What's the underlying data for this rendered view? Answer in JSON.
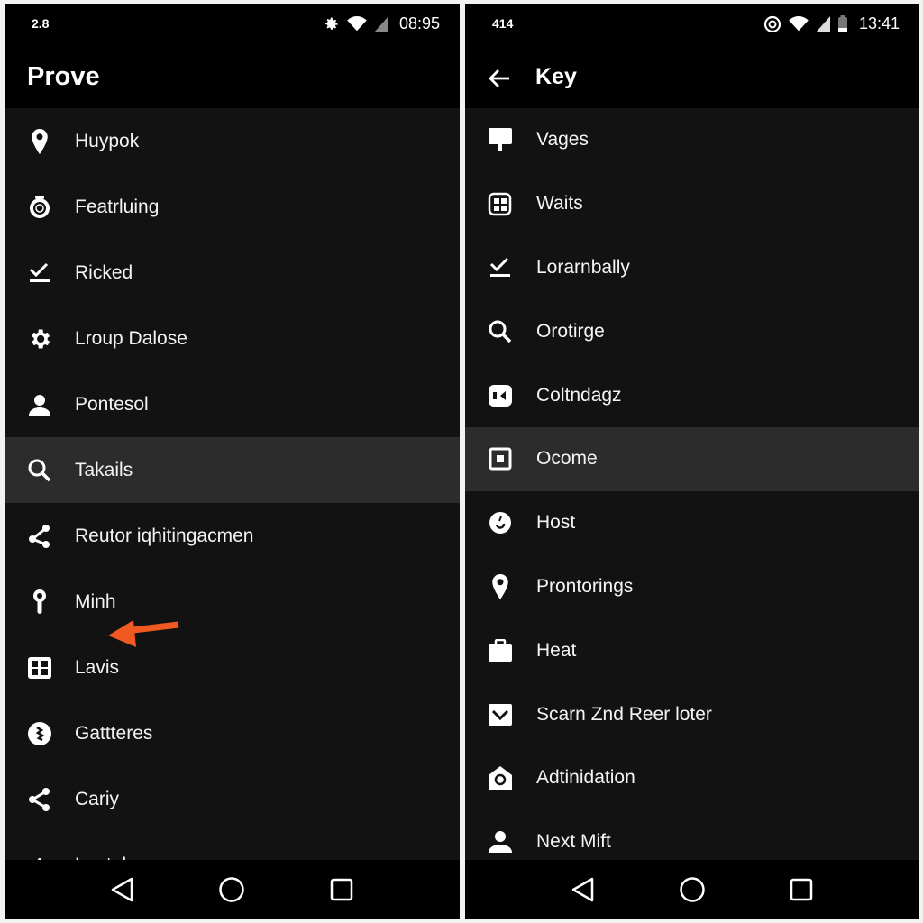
{
  "left_screen": {
    "status": {
      "left_text": "2.8",
      "time": "08:95",
      "icons": [
        "settings-icon",
        "wifi-icon",
        "signal-icon"
      ]
    },
    "title": "Prove",
    "items": [
      {
        "icon": "location-pin-icon",
        "label": "Huypok"
      },
      {
        "icon": "camera-ring-icon",
        "label": "Featrluing"
      },
      {
        "icon": "download-check-icon",
        "label": "Ricked"
      },
      {
        "icon": "gear-icon",
        "label": "Lroup Dalose"
      },
      {
        "icon": "person-icon",
        "label": "Pontesol"
      },
      {
        "icon": "search-icon",
        "label": "Takails",
        "selected": true
      },
      {
        "icon": "share-icon",
        "label": "Reutor iqhitingacmen"
      },
      {
        "icon": "key-pin-icon",
        "label": "Minh"
      },
      {
        "icon": "grid-card-icon",
        "label": "Lavis"
      },
      {
        "icon": "badge-circle-icon",
        "label": "Gattteres"
      },
      {
        "icon": "share-icon",
        "label": "Cariy"
      },
      {
        "icon": "bar-icon",
        "label": "Lautolas"
      }
    ],
    "annotation": {
      "type": "arrow",
      "color": "#f05a22",
      "points_to": "Minh"
    }
  },
  "right_screen": {
    "status": {
      "left_text": "414",
      "time": "13:41",
      "icons": [
        "at-icon",
        "wifi-icon",
        "signal-icon",
        "battery-icon"
      ]
    },
    "title": "Key",
    "items": [
      {
        "icon": "sign-icon",
        "label": "Vages"
      },
      {
        "icon": "grid-box-icon",
        "label": "Waits"
      },
      {
        "icon": "download-check-icon",
        "label": "Lorarnbally"
      },
      {
        "icon": "search-icon",
        "label": "Orotirge"
      },
      {
        "icon": "media-icon",
        "label": "Coltndagz"
      },
      {
        "icon": "square-target-icon",
        "label": "Ocome",
        "selected": true
      },
      {
        "icon": "circle-dot-icon",
        "label": "Host"
      },
      {
        "icon": "location-pin-icon",
        "label": "Prontorings"
      },
      {
        "icon": "briefcase-icon",
        "label": "Heat"
      },
      {
        "icon": "checkbox-icon",
        "label": "Scarn Znd Reer loter"
      },
      {
        "icon": "home-icon",
        "label": "Adtinidation"
      },
      {
        "icon": "person-icon",
        "label": "Next Mift"
      }
    ]
  },
  "navbar": {
    "buttons": [
      "back",
      "home",
      "recents"
    ]
  },
  "colors": {
    "accent_arrow": "#f05a22",
    "background": "#121212",
    "bar": "#000000",
    "selected": "#2c2c2c"
  }
}
